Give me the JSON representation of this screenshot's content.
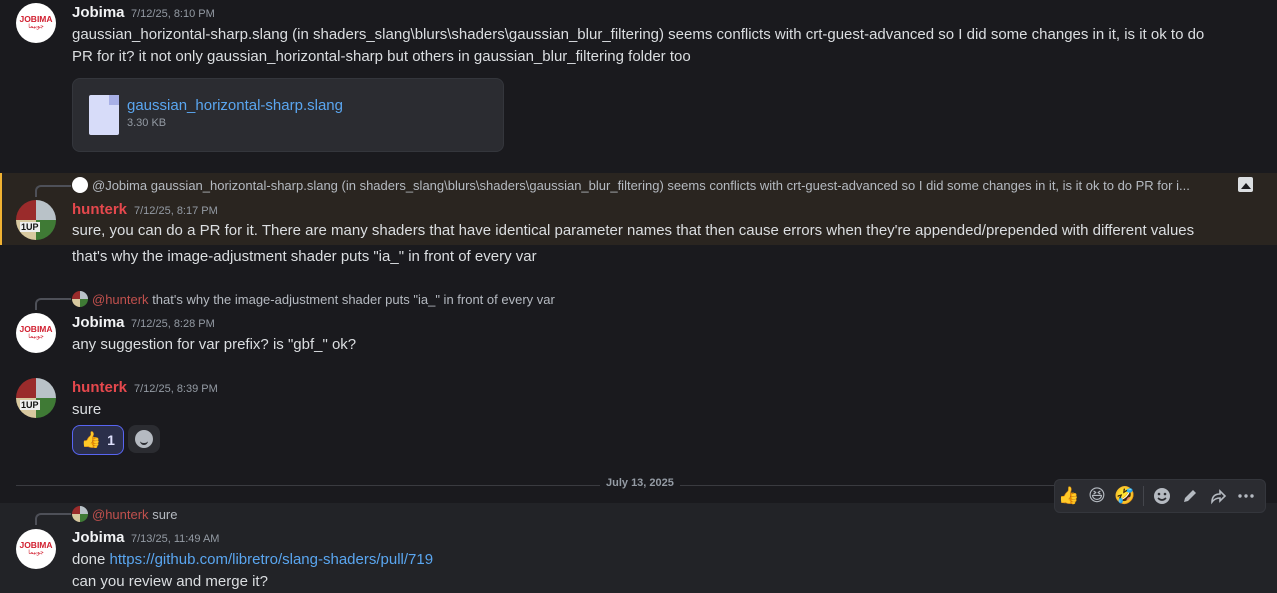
{
  "messages": [
    {
      "author": "Jobima",
      "timestamp": "7/12/25, 8:10 PM",
      "text_lines": [
        "gaussian_horizontal-sharp.slang (in shaders_slang\\blurs\\shaders\\gaussian_blur_filtering) seems conflicts with crt-guest-advanced so I did some changes in it, is it ok to do",
        "PR for it? it not only gaussian_horizontal-sharp but others in gaussian_blur_filtering folder too"
      ],
      "attachment": {
        "name": "gaussian_horizontal-sharp.slang",
        "size": "3.30 KB"
      }
    },
    {
      "reply": {
        "mention": "@Jobima",
        "preview": "gaussian_horizontal-sharp.slang (in shaders_slang\\blurs\\shaders\\gaussian_blur_filtering) seems conflicts with crt-guest-advanced so I did some changes in it, is it ok to do PR for i..."
      },
      "author": "hunterk",
      "timestamp": "7/12/25, 8:17 PM",
      "text_lines": [
        "sure, you can do a PR for it. There are many shaders that have identical parameter names that then cause errors when they're appended/prepended with different values",
        "that's why the image-adjustment shader puts \"ia_\" in front of every var"
      ]
    },
    {
      "reply": {
        "mention": "@hunterk",
        "preview": "that's why the image-adjustment shader puts \"ia_\" in front of every var"
      },
      "author": "Jobima",
      "timestamp": "7/12/25, 8:28 PM",
      "text_lines": [
        "any suggestion for var prefix? is \"gbf_\" ok?"
      ]
    },
    {
      "author": "hunterk",
      "timestamp": "7/12/25, 8:39 PM",
      "text_lines": [
        "sure"
      ],
      "reaction": {
        "emoji": "👍",
        "count": "1"
      }
    },
    {
      "reply": {
        "mention": "@hunterk",
        "preview": "sure"
      },
      "author": "Jobima",
      "timestamp": "7/13/25, 11:49 AM",
      "text_prefix": "done ",
      "link": "https://github.com/libretro/slang-shaders/pull/719",
      "text_lines": [
        "can you review and merge it?"
      ]
    }
  ],
  "avatar": {
    "jobima_text": "JOBIMA",
    "jobima_sub": "جوبيما",
    "hunter_text": "1UP"
  },
  "date_divider": "July 13, 2025",
  "toolbar": {
    "reactions": [
      "👍",
      "😆",
      "🤣"
    ],
    "icons": [
      "add-reaction-icon",
      "edit-icon",
      "forward-icon",
      "more-icon"
    ]
  },
  "colors": {
    "accent": "#5865f2",
    "hunter_name": "#e5484d",
    "link": "#5aa6f0",
    "highlight_bar": "#f0b232"
  }
}
